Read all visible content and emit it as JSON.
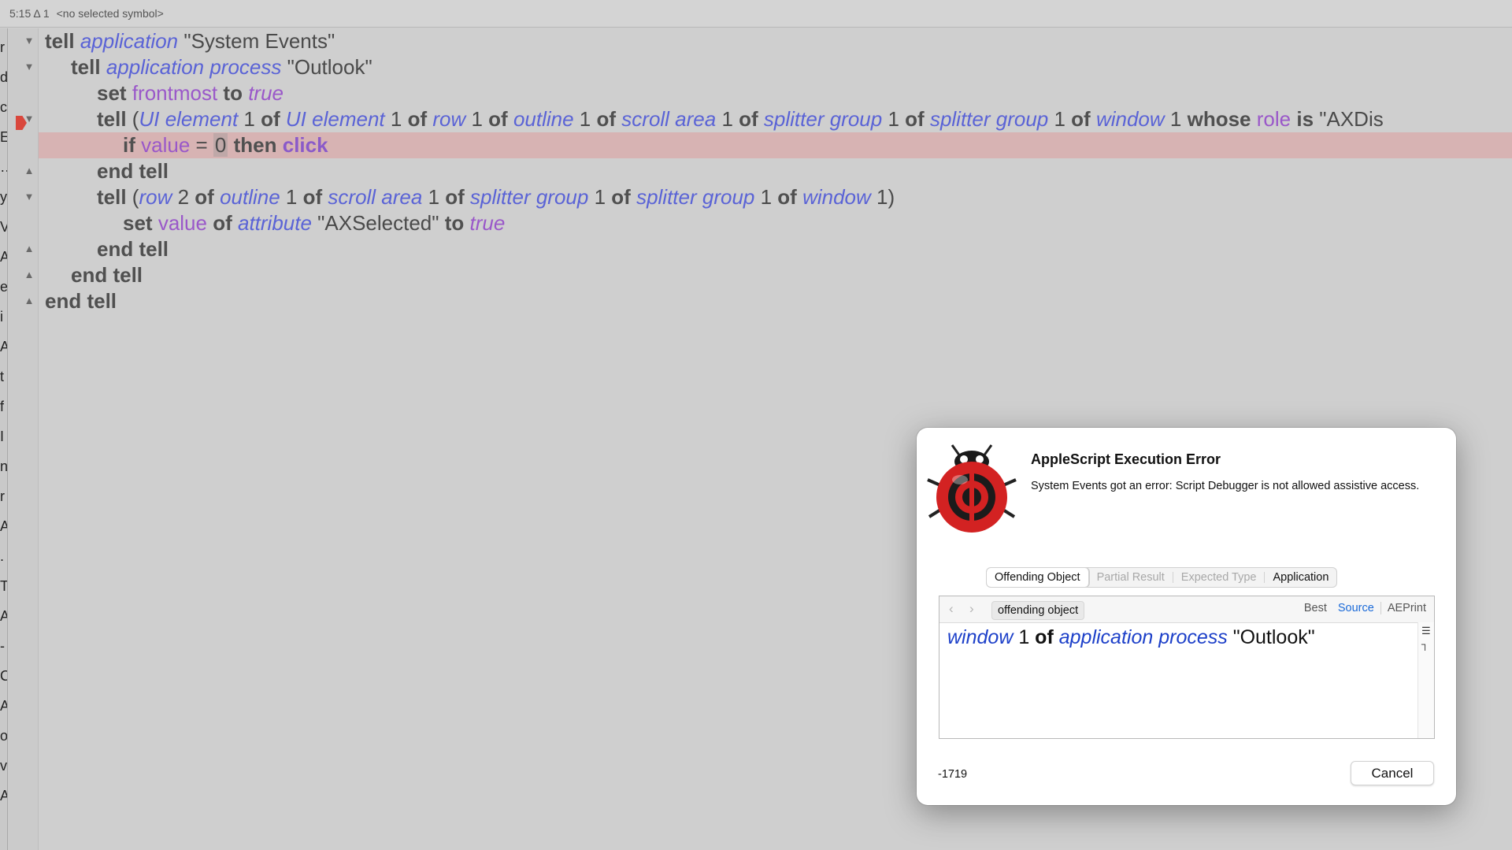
{
  "statusbar": {
    "position": "5:15 Δ 1",
    "symbol": "<no selected symbol>"
  },
  "left_sliver_chars": [
    "r",
    "d",
    "c",
    "E",
    "…",
    "y",
    "V",
    "A",
    "e",
    "i",
    "A",
    "t",
    "f",
    "I",
    "n",
    "r",
    "A",
    ".",
    "T",
    "A",
    "-",
    "C",
    "A",
    "o",
    "v",
    "A"
  ],
  "editor": {
    "fold_markers": [
      {
        "line": 1,
        "glyph": "▼"
      },
      {
        "line": 2,
        "glyph": "▼"
      },
      {
        "line": 4,
        "glyph": "▼"
      },
      {
        "line": 6,
        "glyph": "▲"
      },
      {
        "line": 7,
        "glyph": "▼"
      },
      {
        "line": 9,
        "glyph": "▲"
      },
      {
        "line": 10,
        "glyph": "▲"
      },
      {
        "line": 11,
        "glyph": "▲"
      }
    ],
    "lines": [
      {
        "indent": 0,
        "tokens": [
          {
            "t": "kw",
            "v": "tell"
          },
          {
            "t": "sp",
            "v": " "
          },
          {
            "t": "cls",
            "v": "application"
          },
          {
            "t": "sp",
            "v": " "
          },
          {
            "t": "str",
            "v": "\"System Events\""
          }
        ]
      },
      {
        "indent": 1,
        "tokens": [
          {
            "t": "kw",
            "v": "tell"
          },
          {
            "t": "sp",
            "v": " "
          },
          {
            "t": "cls",
            "v": "application process"
          },
          {
            "t": "sp",
            "v": " "
          },
          {
            "t": "str",
            "v": "\"Outlook\""
          }
        ]
      },
      {
        "indent": 2,
        "tokens": [
          {
            "t": "kw",
            "v": "set"
          },
          {
            "t": "sp",
            "v": " "
          },
          {
            "t": "prop",
            "v": "frontmost"
          },
          {
            "t": "sp",
            "v": " "
          },
          {
            "t": "kw",
            "v": "to"
          },
          {
            "t": "sp",
            "v": " "
          },
          {
            "t": "const",
            "v": "true"
          }
        ]
      },
      {
        "indent": 2,
        "tokens": [
          {
            "t": "kw",
            "v": "tell"
          },
          {
            "t": "sp",
            "v": " ("
          },
          {
            "t": "cls",
            "v": "UI element"
          },
          {
            "t": "num",
            "v": " 1 "
          },
          {
            "t": "kw",
            "v": "of"
          },
          {
            "t": "sp",
            "v": " "
          },
          {
            "t": "cls",
            "v": "UI element"
          },
          {
            "t": "num",
            "v": " 1 "
          },
          {
            "t": "kw",
            "v": "of"
          },
          {
            "t": "sp",
            "v": " "
          },
          {
            "t": "cls",
            "v": "row"
          },
          {
            "t": "num",
            "v": " 1 "
          },
          {
            "t": "kw",
            "v": "of"
          },
          {
            "t": "sp",
            "v": " "
          },
          {
            "t": "cls",
            "v": "outline"
          },
          {
            "t": "num",
            "v": " 1 "
          },
          {
            "t": "kw",
            "v": "of"
          },
          {
            "t": "sp",
            "v": " "
          },
          {
            "t": "cls",
            "v": "scroll area"
          },
          {
            "t": "num",
            "v": " 1 "
          },
          {
            "t": "kw",
            "v": "of"
          },
          {
            "t": "sp",
            "v": " "
          },
          {
            "t": "cls",
            "v": "splitter group"
          },
          {
            "t": "num",
            "v": " 1 "
          },
          {
            "t": "kw",
            "v": "of"
          },
          {
            "t": "sp",
            "v": " "
          },
          {
            "t": "cls",
            "v": "splitter group"
          },
          {
            "t": "num",
            "v": " 1 "
          },
          {
            "t": "kw",
            "v": "of"
          },
          {
            "t": "sp",
            "v": " "
          },
          {
            "t": "cls",
            "v": "window"
          },
          {
            "t": "num",
            "v": " 1 "
          },
          {
            "t": "kw",
            "v": "whose"
          },
          {
            "t": "sp",
            "v": " "
          },
          {
            "t": "prop",
            "v": "role"
          },
          {
            "t": "sp",
            "v": " "
          },
          {
            "t": "kw",
            "v": "is"
          },
          {
            "t": "str",
            "v": " \"AXDis"
          }
        ]
      },
      {
        "indent": 3,
        "error": true,
        "tokens": [
          {
            "t": "kw",
            "v": "if"
          },
          {
            "t": "sp",
            "v": " "
          },
          {
            "t": "prop",
            "v": "value"
          },
          {
            "t": "sp",
            "v": " = "
          },
          {
            "t": "numhl",
            "v": "0"
          },
          {
            "t": "sp",
            "v": " "
          },
          {
            "t": "kw",
            "v": "then"
          },
          {
            "t": "sp",
            "v": " "
          },
          {
            "t": "cmd",
            "v": "click"
          }
        ]
      },
      {
        "indent": 2,
        "tokens": [
          {
            "t": "kw",
            "v": "end tell"
          }
        ]
      },
      {
        "indent": 2,
        "tokens": [
          {
            "t": "kw",
            "v": "tell"
          },
          {
            "t": "sp",
            "v": " ("
          },
          {
            "t": "cls",
            "v": "row"
          },
          {
            "t": "num",
            "v": " 2 "
          },
          {
            "t": "kw",
            "v": "of"
          },
          {
            "t": "sp",
            "v": " "
          },
          {
            "t": "cls",
            "v": "outline"
          },
          {
            "t": "num",
            "v": " 1 "
          },
          {
            "t": "kw",
            "v": "of"
          },
          {
            "t": "sp",
            "v": " "
          },
          {
            "t": "cls",
            "v": "scroll area"
          },
          {
            "t": "num",
            "v": " 1 "
          },
          {
            "t": "kw",
            "v": "of"
          },
          {
            "t": "sp",
            "v": " "
          },
          {
            "t": "cls",
            "v": "splitter group"
          },
          {
            "t": "num",
            "v": " 1 "
          },
          {
            "t": "kw",
            "v": "of"
          },
          {
            "t": "sp",
            "v": " "
          },
          {
            "t": "cls",
            "v": "splitter group"
          },
          {
            "t": "num",
            "v": " 1 "
          },
          {
            "t": "kw",
            "v": "of"
          },
          {
            "t": "sp",
            "v": " "
          },
          {
            "t": "cls",
            "v": "window"
          },
          {
            "t": "num",
            "v": " 1)"
          }
        ]
      },
      {
        "indent": 3,
        "tokens": [
          {
            "t": "kw",
            "v": "set"
          },
          {
            "t": "sp",
            "v": " "
          },
          {
            "t": "prop",
            "v": "value"
          },
          {
            "t": "sp",
            "v": " "
          },
          {
            "t": "kw",
            "v": "of"
          },
          {
            "t": "sp",
            "v": " "
          },
          {
            "t": "cls",
            "v": "attribute"
          },
          {
            "t": "sp",
            "v": " "
          },
          {
            "t": "str",
            "v": "\"AXSelected\""
          },
          {
            "t": "sp",
            "v": " "
          },
          {
            "t": "kw",
            "v": "to"
          },
          {
            "t": "sp",
            "v": " "
          },
          {
            "t": "const",
            "v": "true"
          }
        ]
      },
      {
        "indent": 2,
        "tokens": [
          {
            "t": "kw",
            "v": "end tell"
          }
        ]
      },
      {
        "indent": 1,
        "tokens": [
          {
            "t": "kw",
            "v": "end tell"
          }
        ]
      },
      {
        "indent": 0,
        "tokens": [
          {
            "t": "kw",
            "v": "end tell"
          }
        ]
      }
    ]
  },
  "dialog": {
    "title": "AppleScript Execution Error",
    "message": "System Events got an error: Script Debugger is not allowed assistive access.",
    "tabs": [
      {
        "label": "Offending Object",
        "state": "selected"
      },
      {
        "label": "Partial Result",
        "state": "disabled"
      },
      {
        "label": "Expected Type",
        "state": "disabled"
      },
      {
        "label": "Application",
        "state": "enabled"
      }
    ],
    "panel": {
      "object_label": "offending object",
      "views": [
        "Best",
        "Source",
        "AEPrint"
      ],
      "active_view": "Source",
      "content_tokens": [
        {
          "t": "cls",
          "v": "window"
        },
        {
          "t": "sp",
          "v": " 1 "
        },
        {
          "t": "kw",
          "v": "of"
        },
        {
          "t": "sp",
          "v": " "
        },
        {
          "t": "cls",
          "v": "application process"
        },
        {
          "t": "sp",
          "v": " \"Outlook\""
        }
      ]
    },
    "error_code": "-1719",
    "cancel_label": "Cancel"
  }
}
